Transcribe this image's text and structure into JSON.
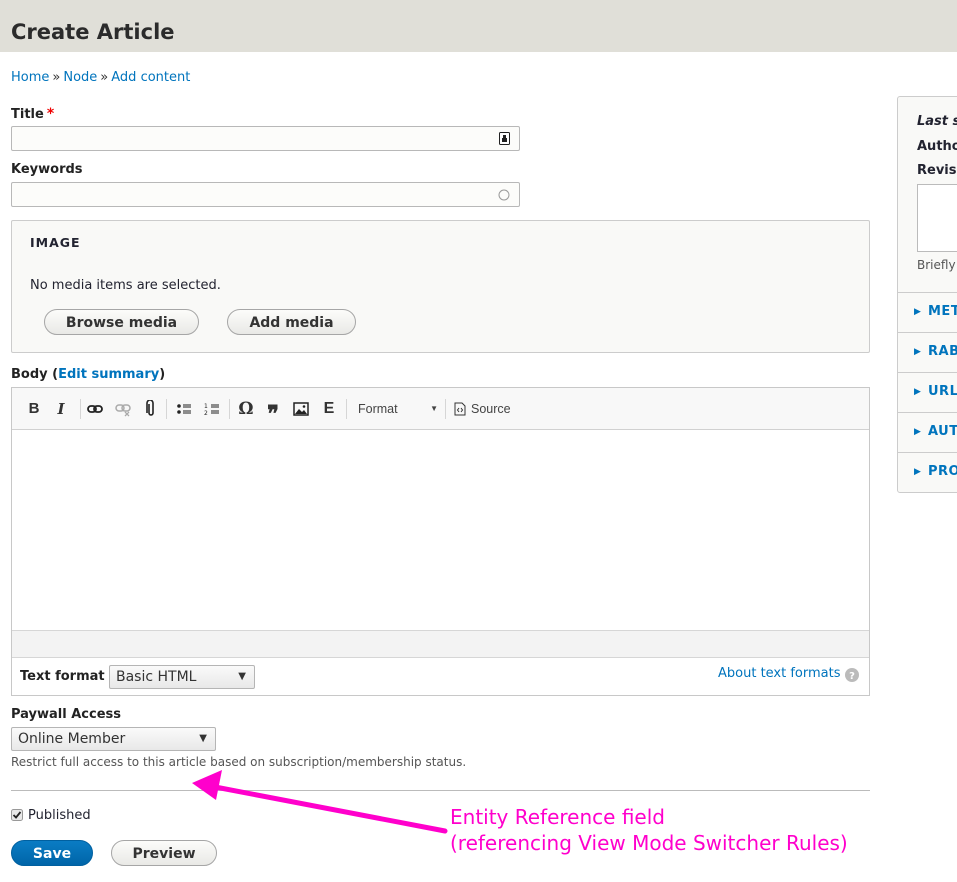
{
  "page": {
    "title": "Create Article"
  },
  "breadcrumb": [
    {
      "label": "Home"
    },
    {
      "label": "Node"
    },
    {
      "label": "Add content"
    }
  ],
  "breadcrumb_separator": "»",
  "fields": {
    "title": {
      "label": "Title",
      "required_marker": "*",
      "value": ""
    },
    "keywords": {
      "label": "Keywords",
      "value": ""
    },
    "image": {
      "legend": "IMAGE",
      "message": "No media items are selected.",
      "browse_label": "Browse media",
      "add_label": "Add media"
    },
    "body": {
      "label": "Body",
      "edit_summary_label": "Edit summary",
      "toolbar": {
        "bold": "B",
        "italic": "I",
        "link": "link-icon",
        "unlink": "unlink-icon",
        "attach": "paperclip-icon",
        "bullets": "bulleted-list-icon",
        "numbers": "numbered-list-icon",
        "special_char": "Ω",
        "quote": "❞",
        "image": "image-icon",
        "embed": "E",
        "format_label": "Format",
        "source_label": "Source"
      },
      "text_format_label": "Text format",
      "text_format_value": "Basic HTML",
      "about_formats_label": "About text formats"
    },
    "paywall": {
      "label": "Paywall Access",
      "value": "Online Member",
      "description": "Restrict full access to this article based on subscription/membership status."
    },
    "published": {
      "label": "Published",
      "checked": true
    }
  },
  "actions": {
    "save_label": "Save",
    "preview_label": "Preview"
  },
  "sidebar": {
    "last_saved": "Last s",
    "author": "Autho",
    "revision": "Revisi",
    "revision_help": "Briefly",
    "sections": [
      {
        "label": "MET"
      },
      {
        "label": "RAB"
      },
      {
        "label": "URL"
      },
      {
        "label": "AUT"
      },
      {
        "label": "PRO"
      }
    ]
  },
  "annotation": {
    "line1": "Entity Reference field",
    "line2": "(referencing View Mode Switcher Rules)",
    "color": "#ff00cc"
  }
}
